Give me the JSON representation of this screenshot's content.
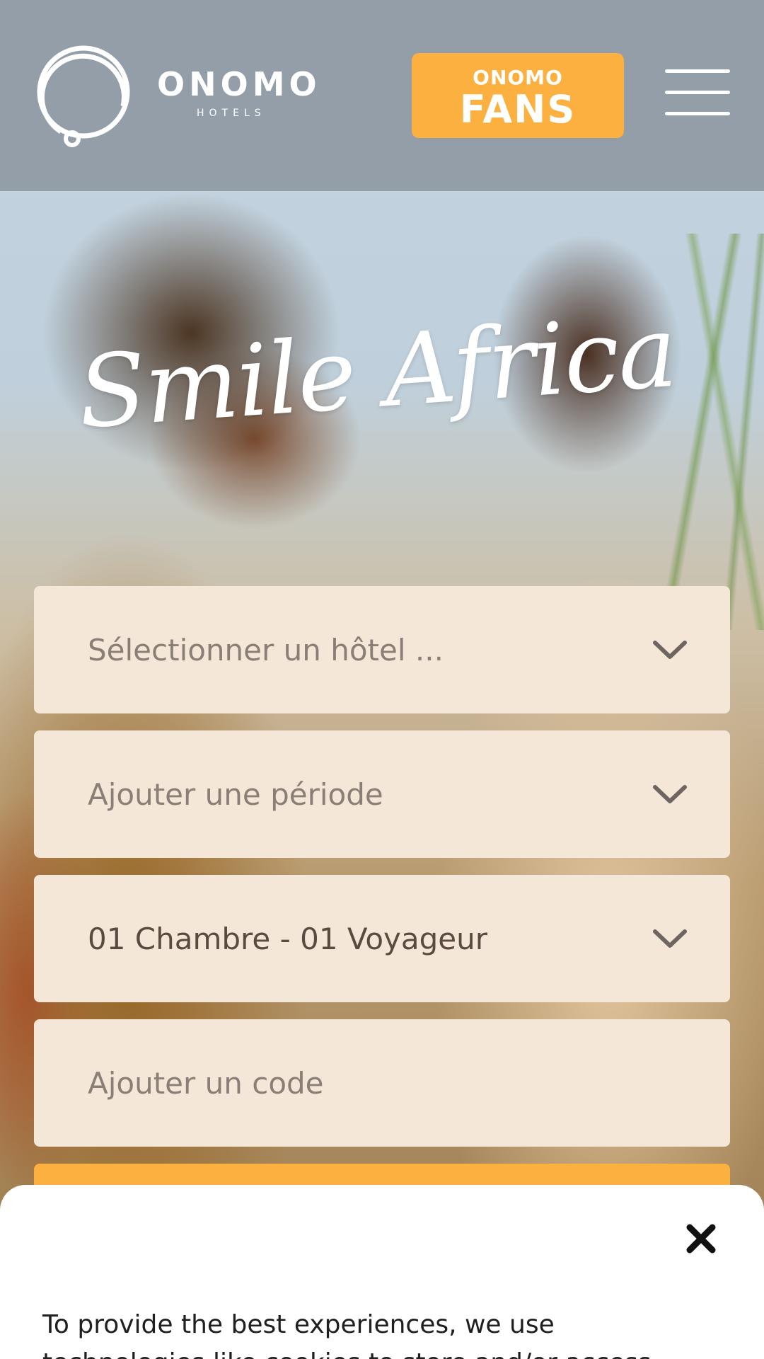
{
  "header": {
    "logo_word": "ONOMO",
    "logo_sub": "HOTELS",
    "fans_button": {
      "top": "ONOMO",
      "main": "FANS"
    }
  },
  "hero": {
    "headline": "Smile Africa"
  },
  "booking": {
    "hotel_placeholder": "Sélectionner un hôtel ...",
    "period_placeholder": "Ajouter une période",
    "rooms_value": "01 Chambre - 01 Voyageur",
    "code_placeholder": "Ajouter un code"
  },
  "cookie_banner": {
    "text": "To provide the best experiences, we use technologies like cookies to store and/or access"
  },
  "colors": {
    "accent": "#fbb040",
    "field_bg": "#f5e7d8",
    "header_overlay": "#8c96a0"
  }
}
